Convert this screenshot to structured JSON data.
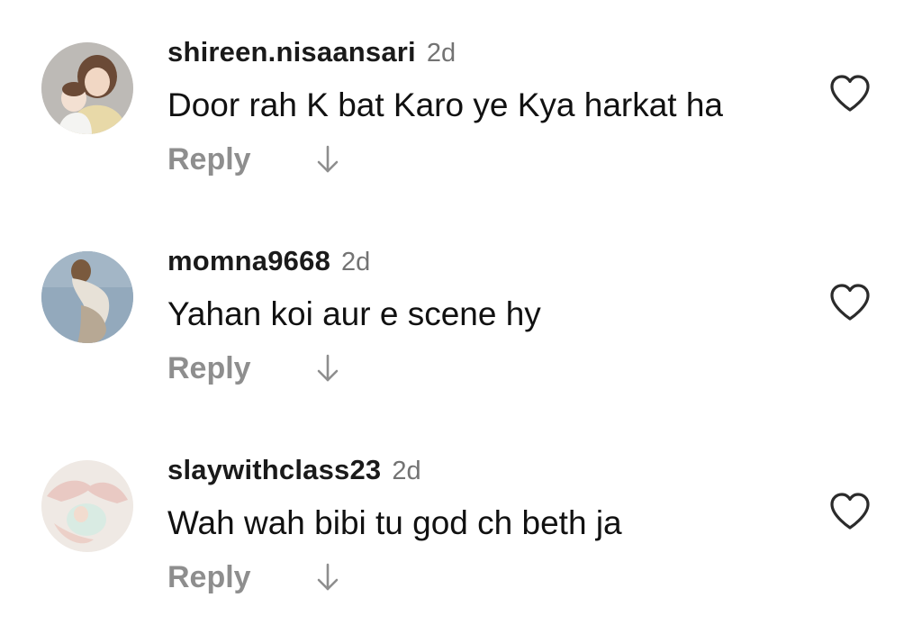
{
  "comments": [
    {
      "username": "shireen.nisaansari",
      "time": "2d",
      "text": "Door rah K bat Karo ye Kya harkat ha",
      "reply_label": "Reply"
    },
    {
      "username": "momna9668",
      "time": "2d",
      "text": "Yahan koi aur e scene hy",
      "reply_label": "Reply"
    },
    {
      "username": "slaywithclass23",
      "time": "2d",
      "text": "Wah wah bibi tu god ch beth ja",
      "reply_label": "Reply"
    }
  ],
  "icons": {
    "like": "heart-outline-icon",
    "expand_replies": "arrow-down-icon"
  },
  "colors": {
    "background": "#ffffff",
    "primary_text": "#111111",
    "secondary_text": "#737373",
    "reply_text": "#8e8e8e"
  }
}
